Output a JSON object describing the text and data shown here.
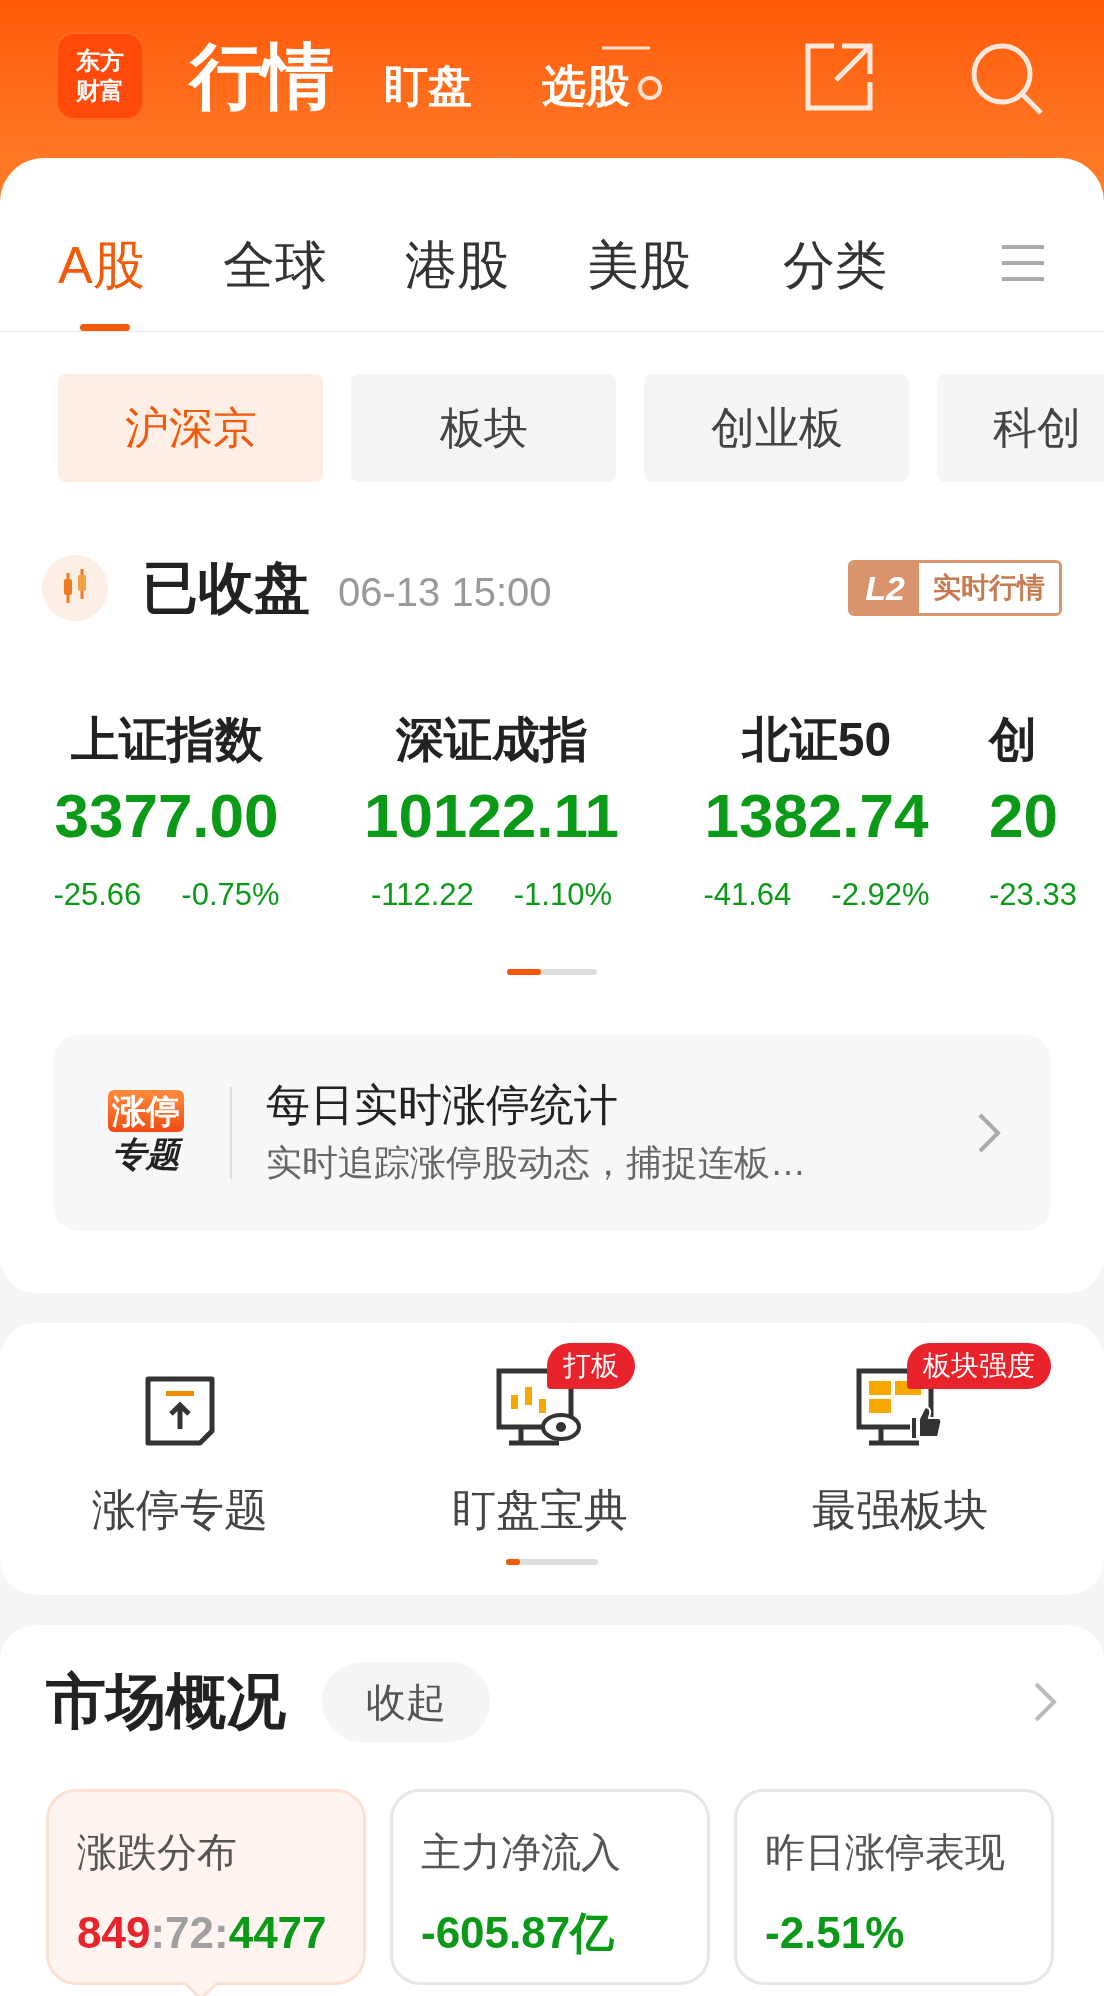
{
  "header": {
    "logo_lines": [
      "东方",
      "财富"
    ],
    "title": "行情",
    "nav": [
      {
        "label": "盯盘"
      },
      {
        "label": "选股"
      }
    ]
  },
  "tabs": [
    {
      "label": "A股",
      "selected": true
    },
    {
      "label": "全球",
      "selected": false
    },
    {
      "label": "港股",
      "selected": false
    },
    {
      "label": "美股",
      "selected": false
    },
    {
      "label": "分类",
      "selected": false
    }
  ],
  "chips": [
    {
      "label": "沪深京",
      "selected": true
    },
    {
      "label": "板块",
      "selected": false
    },
    {
      "label": "创业板",
      "selected": false
    },
    {
      "label": "科创",
      "selected": false
    }
  ],
  "status": {
    "label": "已收盘",
    "time": "06-13 15:00",
    "badge_tag": "L2",
    "badge_text": "实时行情"
  },
  "indices": [
    {
      "name": "上证指数",
      "value": "3377.00",
      "change": "-25.66",
      "pct": "-0.75%"
    },
    {
      "name": "深证成指",
      "value": "10122.11",
      "change": "-112.22",
      "pct": "-1.10%"
    },
    {
      "name": "北证50",
      "value": "1382.74",
      "change": "-41.64",
      "pct": "-2.92%"
    },
    {
      "name": "创",
      "value": "20",
      "change": "-23.33"
    }
  ],
  "banner": {
    "tag_lines": [
      "涨停",
      "专题"
    ],
    "title": "每日实时涨停统计",
    "subtitle": "实时追踪涨停股动态，捕捉连板…"
  },
  "shortcuts": [
    {
      "kind": "upload",
      "label": "涨停专题"
    },
    {
      "kind": "monitor-eye",
      "label": "盯盘宝典",
      "badge": "打板"
    },
    {
      "kind": "monitor-like",
      "label": "最强板块",
      "badge": "板块强度"
    }
  ],
  "overview": {
    "title": "市场概况",
    "toggle": "收起",
    "cards": [
      {
        "label": "涨跌分布",
        "selected": true,
        "parts": [
          {
            "text": "849",
            "color": "#e8232b"
          },
          {
            "text": ":72:",
            "color": "#a0a0a0"
          },
          {
            "text": "4477",
            "color": "#0b9a17"
          }
        ]
      },
      {
        "label": "主力净流入",
        "selected": false,
        "parts": [
          {
            "text": "-605.87亿",
            "color": "#0b9a17"
          }
        ]
      },
      {
        "label": "昨日涨停表现",
        "selected": false,
        "parts": [
          {
            "text": "-2.51%",
            "color": "#0b9a17"
          }
        ]
      }
    ]
  }
}
